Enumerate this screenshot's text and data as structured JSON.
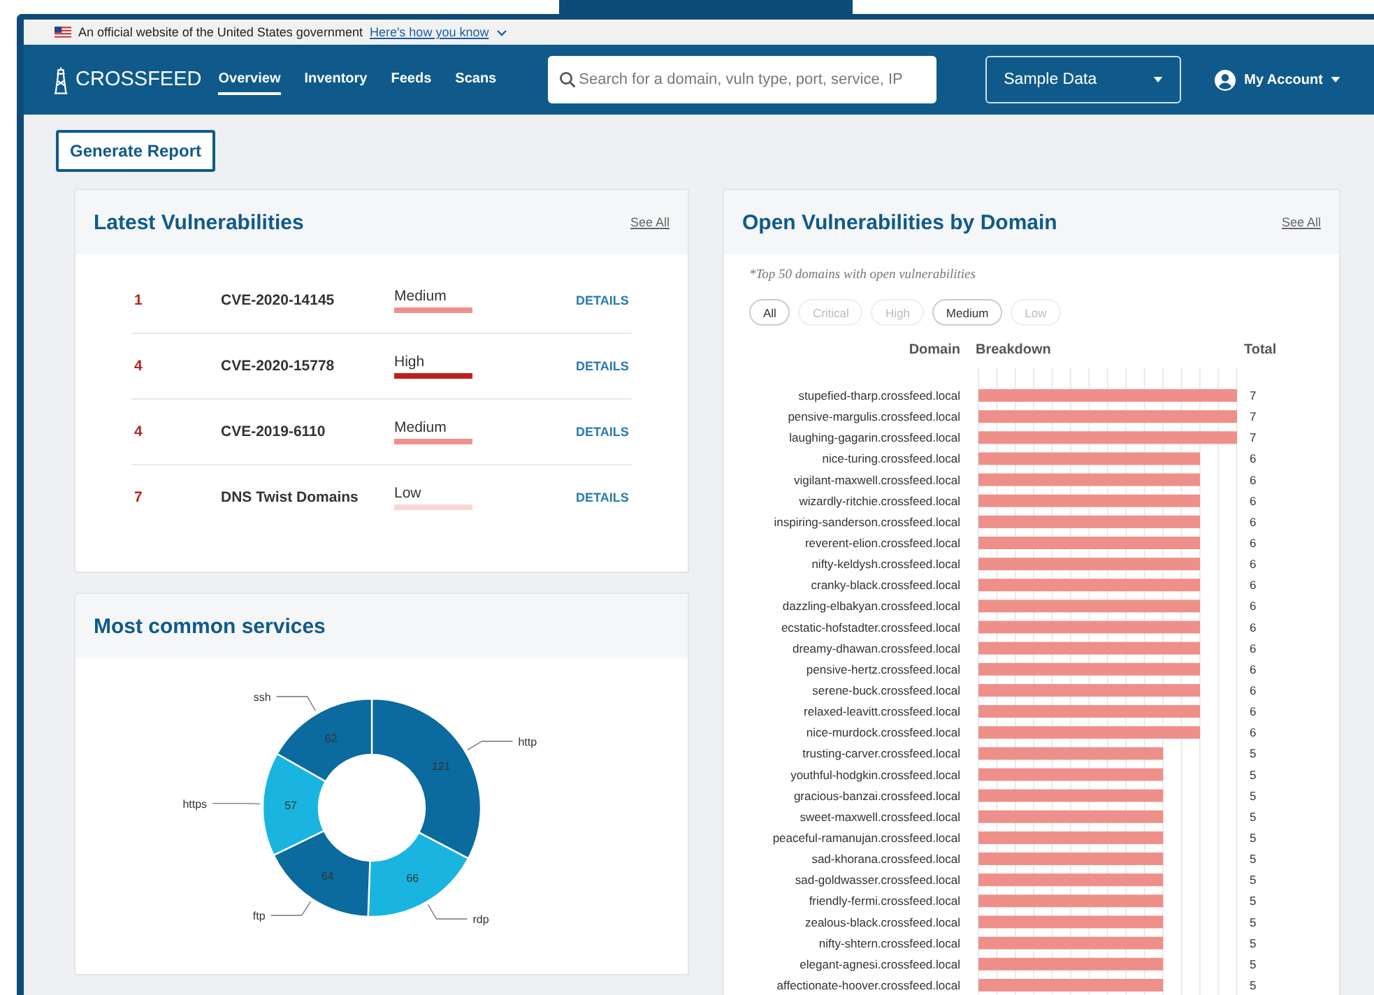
{
  "banner": {
    "text": "An official website of the United States government",
    "link": "Here's how you know"
  },
  "navbar": {
    "logo": "CROSSFEED",
    "items": [
      {
        "label": "Overview",
        "selected": true
      },
      {
        "label": "Inventory",
        "selected": false
      },
      {
        "label": "Feeds",
        "selected": false
      },
      {
        "label": "Scans",
        "selected": false
      }
    ],
    "search": {
      "placeholder": "Search for a domain, vuln type, port, service, IP"
    },
    "data_select": "Sample Data",
    "account": "My Account"
  },
  "toolbar": {
    "button": "Generate Report"
  },
  "latest_vulnerabilities": {
    "title": "Latest Vulnerabilities",
    "see_all": "See All",
    "rows": [
      {
        "count": "1",
        "name": "CVE-2020-14145",
        "severity": "Medium",
        "color": "#ef918b",
        "action": "DETAILS"
      },
      {
        "count": "4",
        "name": "CVE-2020-15778",
        "severity": "High",
        "color": "#c0201c",
        "action": "DETAILS"
      },
      {
        "count": "4",
        "name": "CVE-2019-6110",
        "severity": "Medium",
        "color": "#ef918b",
        "action": "DETAILS"
      },
      {
        "count": "7",
        "name": "DNS Twist Domains",
        "severity": "Low",
        "color": "#f7d6d4",
        "action": "DETAILS"
      }
    ]
  },
  "common_services": {
    "title": "Most common services",
    "chart_data": {
      "type": "donut",
      "categories": [
        "http",
        "rdp",
        "ftp",
        "https",
        "ssh"
      ],
      "values": [
        121,
        66,
        64,
        57,
        62
      ],
      "colors": [
        "#0b6a9e",
        "#19b5e0",
        "#0b6a9e",
        "#19b5e0",
        "#0b6a9e"
      ],
      "data_labels": true
    }
  },
  "open_vulnerabilities": {
    "title": "Open Vulnerabilities by Domain",
    "see_all": "See All",
    "note": "*Top 50 domains with open vulnerabilities",
    "filters": [
      {
        "label": "All",
        "selected": true
      },
      {
        "label": "Critical",
        "selected": false
      },
      {
        "label": "High",
        "selected": false
      },
      {
        "label": "Medium",
        "selected": true
      },
      {
        "label": "Low",
        "selected": false
      }
    ],
    "columns": [
      "Domain",
      "Breakdown",
      "Total"
    ],
    "chart_data": {
      "type": "bar",
      "orientation": "horizontal",
      "categories": [
        "stupefied-tharp.crossfeed.local",
        "pensive-margulis.crossfeed.local",
        "laughing-gagarin.crossfeed.local",
        "nice-turing.crossfeed.local",
        "vigilant-maxwell.crossfeed.local",
        "wizardly-ritchie.crossfeed.local",
        "inspiring-sanderson.crossfeed.local",
        "reverent-elion.crossfeed.local",
        "nifty-keldysh.crossfeed.local",
        "cranky-black.crossfeed.local",
        "dazzling-elbakyan.crossfeed.local",
        "ecstatic-hofstadter.crossfeed.local",
        "dreamy-dhawan.crossfeed.local",
        "pensive-hertz.crossfeed.local",
        "serene-buck.crossfeed.local",
        "relaxed-leavitt.crossfeed.local",
        "nice-murdock.crossfeed.local",
        "trusting-carver.crossfeed.local",
        "youthful-hodgkin.crossfeed.local",
        "gracious-banzai.crossfeed.local",
        "sweet-maxwell.crossfeed.local",
        "peaceful-ramanujan.crossfeed.local",
        "sad-khorana.crossfeed.local",
        "sad-goldwasser.crossfeed.local",
        "friendly-fermi.crossfeed.local",
        "zealous-black.crossfeed.local",
        "nifty-shtern.crossfeed.local",
        "elegant-agnesi.crossfeed.local",
        "affectionate-hoover.crossfeed.local"
      ],
      "series": [
        {
          "color": "#ef8f8a",
          "values": [
            7,
            7,
            7,
            6,
            6,
            6,
            6,
            6,
            6,
            6,
            6,
            6,
            6,
            6,
            6,
            6,
            6,
            5,
            5,
            5,
            5,
            5,
            5,
            5,
            5,
            5,
            5,
            5,
            5
          ]
        }
      ],
      "data_labels": true
    }
  }
}
